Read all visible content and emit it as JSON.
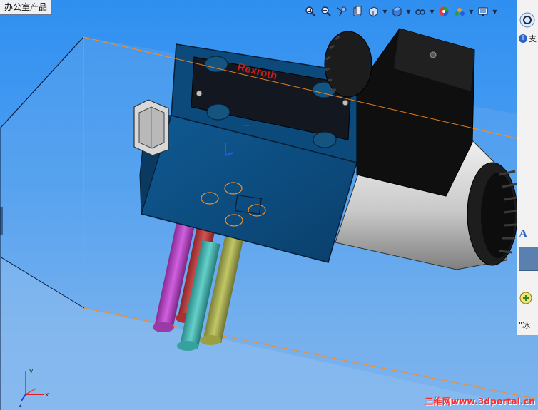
{
  "viewport": {
    "tab_label": "办公室产品",
    "brand_label": "Rexroth",
    "credit_text": "三维网www.3dportal.cn"
  },
  "toolbar": {
    "icons": [
      "zoom-to-fit-icon",
      "zoom-area-icon",
      "rotate-view-icon",
      "section-view-icon",
      "view-orientation-icon",
      "display-style-icon",
      "hide-show-icon",
      "appearance-icon",
      "scene-icon",
      "view-settings-icon"
    ]
  },
  "side_panel": {
    "tab1_text": "支",
    "tab2_text": "A",
    "tab3_text": "\"冰"
  },
  "colors": {
    "background_top": "#2f8ff0",
    "background_bottom": "#86b9ee",
    "valve_body": "#0b4f83",
    "solenoid": "#111111",
    "coil": "#d8d8d8",
    "pipe_magenta": "#b43cc0",
    "pipe_red": "#c23a3a",
    "pipe_teal": "#3fb6b0",
    "pipe_olive": "#a3a84a",
    "edge_highlight": "#ff8a1a",
    "credit": "#ff2a2a"
  }
}
